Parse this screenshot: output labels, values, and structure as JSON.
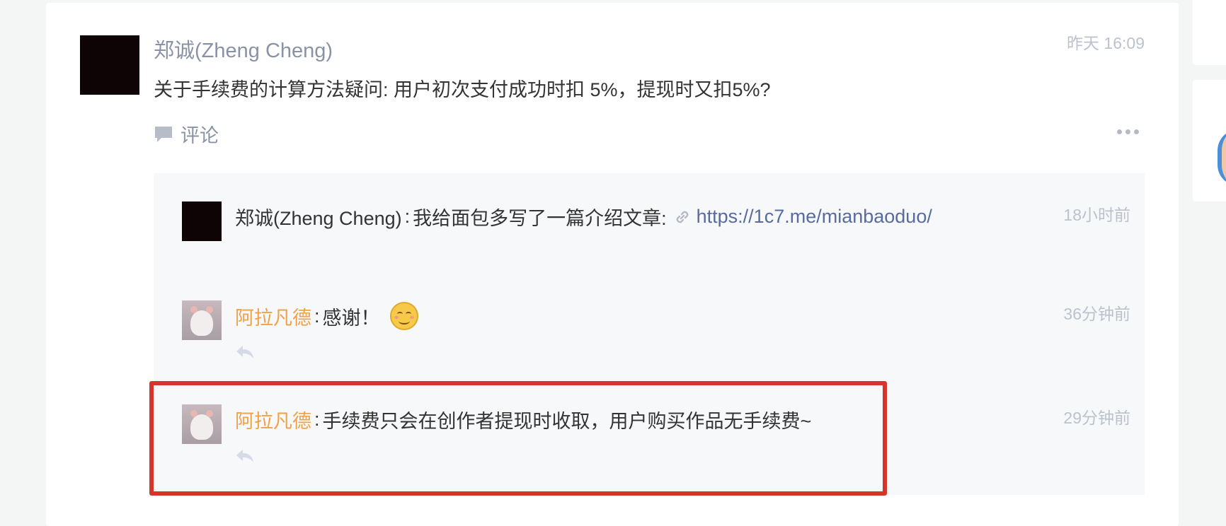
{
  "post": {
    "author": "郑诚(Zheng Cheng)",
    "timestamp": "昨天 16:09",
    "text": "关于手续费的计算方法疑问: 用户初次支付成功时扣 5%，提现时又扣5%?",
    "comment_label": "评论"
  },
  "replies": [
    {
      "name": "郑诚(Zheng Cheng)",
      "separator": ":",
      "text": "我给面包多写了一篇介绍文章: ",
      "link": "https://1c7.me/mianbaoduo/",
      "time": "18小时前"
    },
    {
      "name": "阿拉凡德",
      "separator": ":",
      "text": "感谢！",
      "time": "36分钟前"
    },
    {
      "name": "阿拉凡德",
      "separator": ":",
      "text": "手续费只会在创作者提现时收取，用户购买作品无手续费~",
      "time": "29分钟前"
    }
  ],
  "colors": {
    "accent_name": "#f0a047",
    "link": "#586b9e",
    "highlight_border": "#d5352a"
  },
  "icons": {
    "comment": "speech-bubble-icon",
    "link": "link-icon",
    "reply": "reply-arrow-icon",
    "more": "more-dots-icon",
    "emoji": "smiling-face-emoji"
  }
}
